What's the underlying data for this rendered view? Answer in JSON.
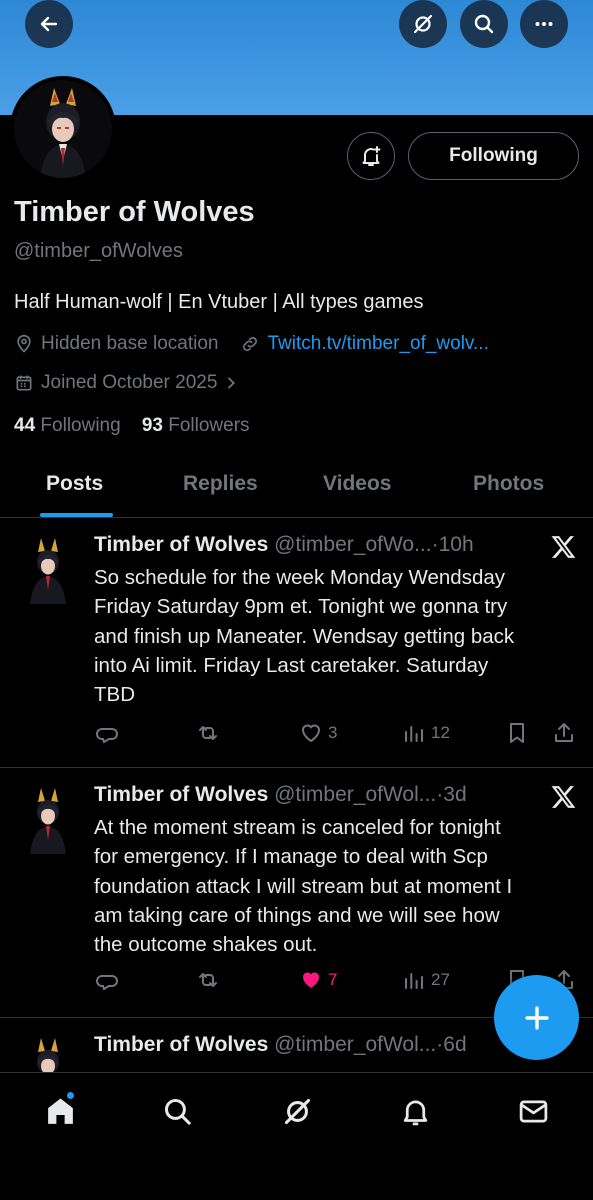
{
  "profile": {
    "display_name": "Timber of Wolves",
    "handle": "@timber_ofWolves",
    "bio": "Half Human-wolf | En Vtuber | All types games",
    "location": "Hidden base location",
    "website": "Twitch.tv/timber_of_wolv...",
    "joined": "Joined October 2025",
    "following_count": "44",
    "following_label": "Following",
    "followers_count": "93",
    "followers_label": "Followers",
    "follow_button_label": "Following"
  },
  "tabs": [
    {
      "label": "Posts",
      "active": true
    },
    {
      "label": "Replies",
      "active": false
    },
    {
      "label": "Videos",
      "active": false
    },
    {
      "label": "Photos",
      "active": false
    }
  ],
  "tweets": [
    {
      "name": "Timber of Wolves",
      "handle": "@timber_ofWo...",
      "dot": "·",
      "time": "10h",
      "lines": [
        "So schedule for the week Monday Wendsday",
        "Friday Saturday 9pm et. Tonight we gonna try",
        "and finish up Maneater. Wendsay getting back",
        "into Ai limit.  Friday Last caretaker. Saturday",
        "TBD"
      ],
      "likes": "3",
      "views": "12"
    },
    {
      "name": "Timber of Wolves",
      "handle": "@timber_ofWol...",
      "dot": "·",
      "time": "3d",
      "lines": [
        "At the moment stream is canceled for tonight",
        "for emergency. If I manage to deal with Scp",
        "foundation attack I will stream but at moment I",
        "am taking care of things and we will see how",
        "the outcome shakes out."
      ],
      "likes": "7",
      "views": "27"
    },
    {
      "name": "Timber of Wolves",
      "handle": "@timber_ofWol...",
      "dot": "·",
      "time": "6d"
    }
  ],
  "icons": {
    "back": "arrow-left-icon",
    "grok": "grok-icon",
    "search": "search-icon",
    "more": "more-icon",
    "notify": "bell-plus-icon",
    "location": "location-pin-icon",
    "link": "link-icon",
    "calendar": "calendar-icon"
  },
  "colors": {
    "accent": "#1d9bf0",
    "like": "#f91880",
    "banner": "#4b9fe6"
  }
}
